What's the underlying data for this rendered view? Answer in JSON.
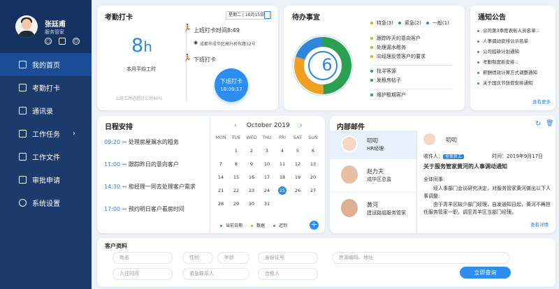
{
  "profile": {
    "name": "张廷甫",
    "role": "服务管家"
  },
  "nav": [
    {
      "label": "我的首页",
      "icon": "home-icon"
    },
    {
      "label": "考勤打卡",
      "icon": "checkin-icon"
    },
    {
      "label": "通讯录",
      "icon": "contacts-icon"
    },
    {
      "label": "工作任务",
      "icon": "tasks-icon",
      "arrow": "›"
    },
    {
      "label": "工作文件",
      "icon": "file-icon"
    },
    {
      "label": "审批申请",
      "icon": "approval-icon"
    },
    {
      "label": "系统设置",
      "icon": "settings-icon"
    }
  ],
  "attendance": {
    "title": "考勤打卡",
    "weekday": "星期二",
    "date": "10月15日",
    "avg_hours": "8",
    "avg_unit": "h",
    "avg_label": "本月平均工时",
    "note": "上班工时已超过公司80%",
    "checkin_label": "上班打卡时间8:49",
    "location": "成都市成华区高升桥东路32号",
    "checkout_label": "下班打卡",
    "btn_label": "下班打卡",
    "btn_time": "18:09:17"
  },
  "todo": {
    "title": "待办事宜",
    "count": "6",
    "legend": [
      {
        "label": "特急",
        "count": "(3)",
        "color": "#f0a020"
      },
      {
        "label": "紧急",
        "count": "(2)",
        "color": "#2aa050"
      },
      {
        "label": "一般",
        "count": "(1)",
        "color": "#2e86de"
      }
    ],
    "items": [
      {
        "text": "跟踪昨天的意向客户",
        "color": "#f0a020"
      },
      {
        "text": "处理漏水租务",
        "color": "#f0a020"
      },
      {
        "text": "向经理反馈客户的要求",
        "color": "#f0a020"
      },
      {
        "text": "找寻客源",
        "color": "#2aa050"
      },
      {
        "text": "发租房帖子",
        "color": "#2aa050"
      },
      {
        "text": "维护租期客户",
        "color": "#2aa050"
      }
    ]
  },
  "notice": {
    "title": "通知公告",
    "items": [
      {
        "text": "公司第3季度表彰人员名单",
        "hot": true
      },
      {
        "text": "人事调动安排公示名单",
        "hot": false
      },
      {
        "text": "公司招新计划通知",
        "hot": false
      },
      {
        "text": "考勤制度新安排",
        "hot": true
      },
      {
        "text": "薪酬绩效计算方式调整通知",
        "hot": false
      },
      {
        "text": "关于国庆节放假安排通知",
        "hot": false
      }
    ],
    "more": "查看更多"
  },
  "schedule": {
    "title": "日程安排",
    "items": [
      {
        "time": "09:20",
        "text": "处理房屋漏水的租务"
      },
      {
        "time": "11:00",
        "text": "跟踪昨日的意向客户"
      },
      {
        "time": "14:30",
        "text": "和经理一同去处理客户需求"
      },
      {
        "time": "17:00",
        "text": "预约明日客户看房时间"
      }
    ],
    "month": "October",
    "year": "2019",
    "weekdays": [
      "MON",
      "TUE",
      "WED",
      "THU",
      "FRI",
      "SAT",
      "SUN"
    ],
    "legend": [
      "当前日期",
      "数据",
      "迟到"
    ]
  },
  "calendar_weeks": [
    [
      "",
      "1",
      "2",
      "3",
      "4",
      "5",
      "6"
    ],
    [
      "7",
      "8",
      "9",
      "10",
      "11",
      "12",
      "13"
    ],
    [
      "14",
      "15",
      "16",
      "17",
      "18",
      "19",
      "20"
    ],
    [
      "21",
      "22",
      "23",
      "24",
      "25",
      "26",
      "27"
    ],
    [
      "28",
      "29",
      "30",
      "31",
      "",
      "",
      ""
    ]
  ],
  "mail": {
    "title": "内部邮件",
    "senders": [
      {
        "name": "叨叨",
        "title": "HR经理"
      },
      {
        "name": "赵力夫",
        "title": "成华区总监"
      },
      {
        "name": "黄河",
        "title": "建设路组服务管家"
      }
    ],
    "detail": {
      "sender": "叨叨",
      "recipient_label": "收件人：",
      "recipient": "全体员工",
      "time": "时间：2019年9月17日",
      "subject": "关于服务管家黄河的人事调动通知",
      "greeting": "全体同事:",
      "body1": "经人事部门会议研究决定，对服务管家黄河做出以下人事调整:",
      "body2": "由于青羊区缺少部门经理，自发通知日起，黄河不再担任服务管家一职，调至青羊区当部门经理。",
      "more": "查看详情"
    }
  },
  "customer": {
    "title": "客户资料",
    "fields": [
      "姓名",
      "性别",
      "年龄",
      "身份证号",
      "房源编码、地址",
      "入住时间",
      "紧急联系人",
      "合租人"
    ],
    "submit": "立即查询"
  }
}
